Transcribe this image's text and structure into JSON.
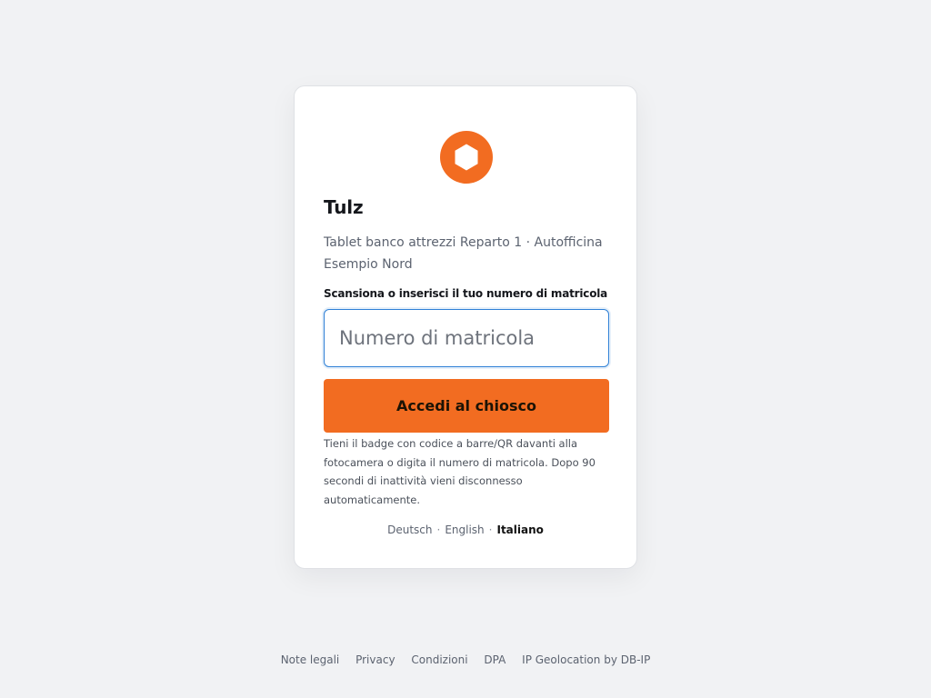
{
  "app": {
    "name": "Tulz",
    "subtitle": "Tablet banco attrezzi Reparto 1 · Autofficina Esempio Nord"
  },
  "login": {
    "field_label": "Scansiona o inserisci il tuo numero di matricola",
    "input_placeholder": "Numero di matricola",
    "input_value": "",
    "submit_label": "Accedi al chiosco",
    "help_text": "Tieni il badge con codice a barre/QR davanti alla fotocamera o digita il numero di matricola. Dopo 90 secondi di inattività vieni disconnesso automaticamente."
  },
  "languages": [
    {
      "label": "Deutsch",
      "active": false
    },
    {
      "label": "English",
      "active": false
    },
    {
      "label": "Italiano",
      "active": true
    }
  ],
  "language_separator": "·",
  "footer": {
    "links": [
      {
        "label": "Note legali"
      },
      {
        "label": "Privacy"
      },
      {
        "label": "Condizioni"
      },
      {
        "label": "DPA"
      },
      {
        "label": "IP Geolocation by DB-IP"
      }
    ]
  },
  "colors": {
    "accent": "#f26c21",
    "focus_border": "#2f80d6",
    "background": "#f1f2f4"
  },
  "icons": {
    "logo": "hexagon-logo-icon"
  }
}
